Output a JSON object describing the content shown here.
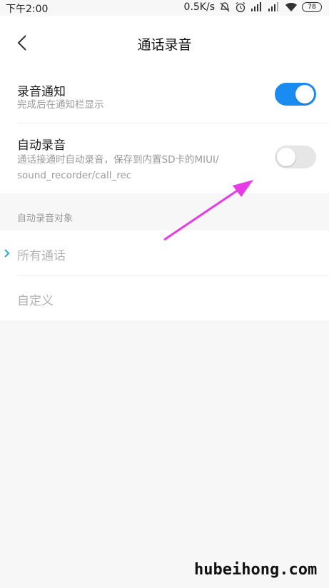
{
  "status_bar": {
    "time": "下午2:00",
    "speed": "0.5K/s",
    "battery": "78",
    "icons": [
      "mute-icon",
      "alarm-icon",
      "hd-signal-icon",
      "signal-icon",
      "wifi-icon",
      "battery-icon"
    ]
  },
  "header": {
    "title": "通话录音",
    "back_icon": "chevron-left-icon"
  },
  "settings": {
    "record_notify": {
      "title": "录音通知",
      "subtitle": "完成后在通知栏显示",
      "enabled": true
    },
    "auto_record": {
      "title": "自动录音",
      "subtitle_line1": "通话接通时自动录音，保存到内置SD卡的MIUI/",
      "subtitle_line2": "sound_recorder/call_rec",
      "enabled": false
    }
  },
  "auto_target": {
    "section_label": "自动录音对象",
    "options": [
      {
        "label": "所有通话",
        "selected": true
      },
      {
        "label": "自定义",
        "selected": false
      }
    ]
  },
  "watermark": "hubeihong.com",
  "colors": {
    "toggle_on": "#1a8cf0",
    "toggle_off": "#e6e6e6",
    "arrow": "#e83be8",
    "chevron_accent": "#2aa9e0"
  }
}
